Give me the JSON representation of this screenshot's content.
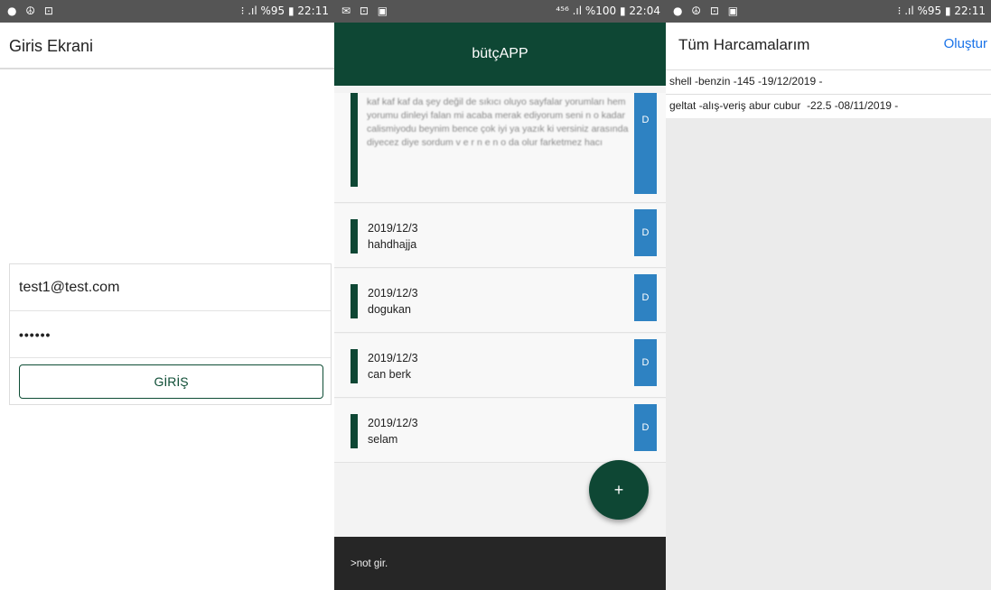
{
  "login_screen": {
    "status_left": "● ☮ ⊡",
    "status_right": "⁝ .ıl %95 ▮ 22:11",
    "title": "Giris Ekrani",
    "email_value": "test1@test.com",
    "password_value": "••••••",
    "login_button_label": "GİRİŞ"
  },
  "notes_screen": {
    "status_left": "✉ ⊡ ▣",
    "status_right": "⁴⁵⁶ .ıl %100 ▮ 22:04",
    "title": "bütçAPP",
    "blurred_note_text": "kaf kaf kaf da şey değil de sıkıcı oluyo sayfalar yorumları hem yorumu dinleyi falan mi acaba merak ediyorum seni n o kadar calismiyodu beynim bence çok iyi ya yazık ki versiniz arasında diyecez diye sordum v e r n e n o da olur farketmez hacı",
    "notes": [
      {
        "date": "2019/12/3",
        "text": "hahdhajja"
      },
      {
        "date": "2019/12/3",
        "text": "dogukan"
      },
      {
        "date": "2019/12/3",
        "text": "can berk"
      },
      {
        "date": "2019/12/3",
        "text": "selam"
      }
    ],
    "delete_label": "D",
    "fab_label": "+",
    "note_input_placeholder": ">not gir."
  },
  "expenses_screen": {
    "status_left": "● ☮ ⊡ ▣",
    "status_right": "⁝ .ıl %95 ▮ 22:11",
    "title": "Tüm Harcamalarım",
    "create_label": "Oluştur",
    "expenses": [
      "shell -benzin -145 -19/12/2019 -",
      "geltat -alış-veriş abur cubur  -22.5 -08/11/2019 -"
    ]
  },
  "colors": {
    "primary_green": "#0e4734",
    "delete_blue": "#2e82c2",
    "link_blue": "#1a73e8",
    "status_bar": "#555555"
  }
}
